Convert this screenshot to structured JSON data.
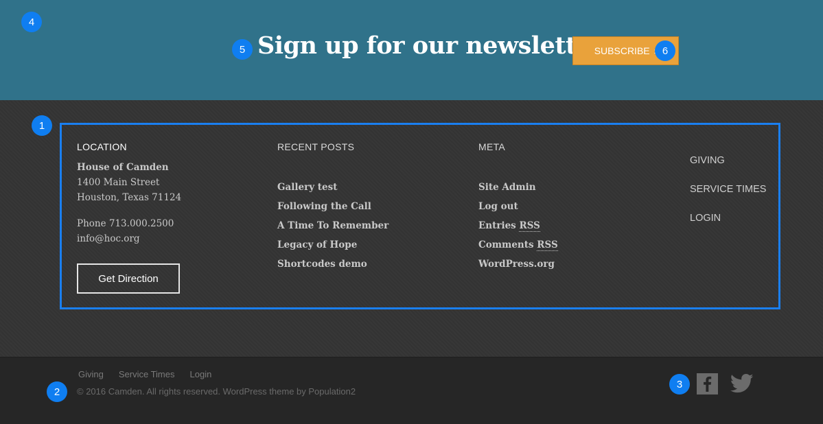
{
  "newsletter": {
    "title": "Sign up for our newsletter",
    "button_label": "SUBSCRIBE",
    "button_arrow": "›"
  },
  "location": {
    "heading": "LOCATION",
    "name": "House of Camden",
    "street": "1400 Main Street",
    "city": "Houston, Texas 71124",
    "phone": "Phone 713.000.2500",
    "email": "info@hoc.org",
    "direction_button": "Get Direction"
  },
  "recent_posts": {
    "heading": "RECENT POSTS",
    "items": [
      "Gallery test",
      "Following the Call",
      "A Time To Remember",
      "Legacy of Hope",
      "Shortcodes demo"
    ]
  },
  "meta": {
    "heading": "META",
    "site_admin": "Site Admin",
    "log_out": "Log out",
    "entries_prefix": "Entries",
    "comments_prefix": "Comments",
    "rss": "RSS",
    "wordpress": "WordPress.org"
  },
  "menu": {
    "items": [
      "GIVING",
      "SERVICE TIMES",
      "LOGIN"
    ]
  },
  "bottom": {
    "links": [
      "Giving",
      "Service Times",
      "Login"
    ],
    "copyright": "© 2016 Camden. All rights reserved. WordPress theme by Population2"
  },
  "markers": [
    "1",
    "2",
    "3",
    "4",
    "5",
    "6"
  ],
  "colors": {
    "newsletter_bg": "#30728a",
    "accent": "#e9a23b",
    "footer_bg": "#343434",
    "bottom_bg": "#262626",
    "highlight": "#1a7ff0"
  },
  "icons": {
    "facebook": "facebook-icon",
    "twitter": "twitter-icon"
  }
}
